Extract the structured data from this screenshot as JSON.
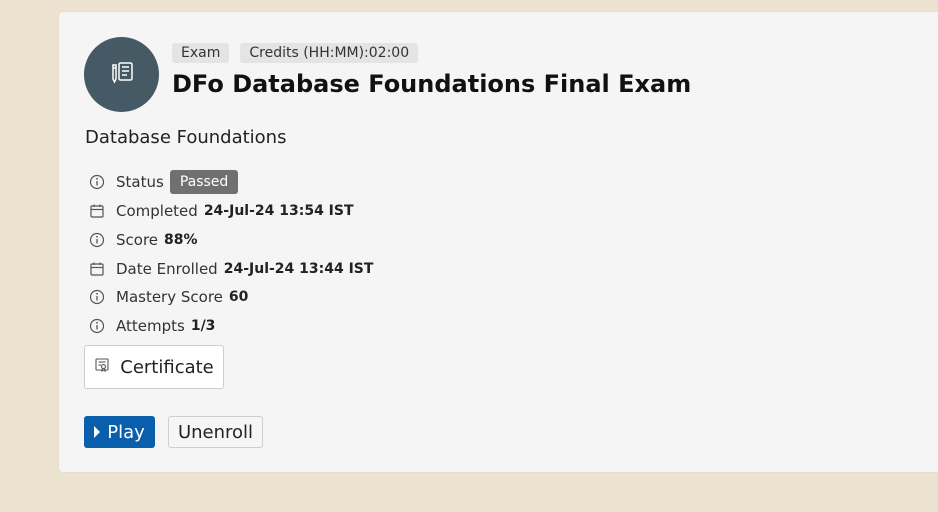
{
  "header": {
    "tags": [
      "Exam",
      "Credits (HH:MM):02:00"
    ],
    "title": "DFo Database Foundations Final Exam",
    "avatar_icon": "exam-icon"
  },
  "course": "Database Foundations",
  "details": {
    "status": {
      "label": "Status",
      "value": "Passed",
      "icon": "info-icon"
    },
    "completed": {
      "label": "Completed",
      "value": "24-Jul-24 13:54 IST",
      "icon": "calendar-icon"
    },
    "score": {
      "label": "Score",
      "value": "88%",
      "icon": "info-icon"
    },
    "date_enrolled": {
      "label": "Date Enrolled",
      "value": "24-Jul-24 13:44 IST",
      "icon": "calendar-icon"
    },
    "mastery_score": {
      "label": "Mastery Score",
      "value": "60",
      "icon": "info-icon"
    },
    "attempts": {
      "label": "Attempts",
      "value": "1/3",
      "icon": "info-icon"
    }
  },
  "actions": {
    "certificate": "Certificate",
    "play": "Play",
    "unenroll": "Unenroll"
  },
  "colors": {
    "page_bg": "#ebe3cf",
    "card_bg": "#f5f5f5",
    "avatar_bg": "#455a64",
    "badge_bg": "#707070",
    "primary": "#0a5fad"
  }
}
